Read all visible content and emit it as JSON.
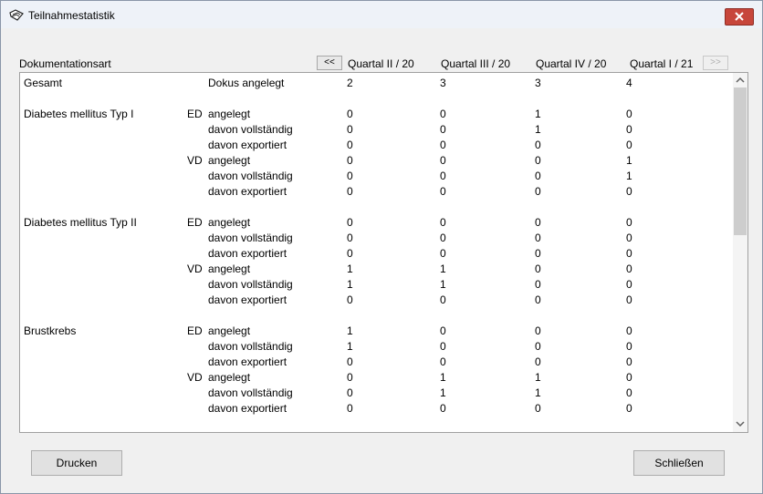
{
  "window": {
    "title": "Teilnahmestatistik",
    "close_icon": "close-icon",
    "app_icon": "app-icon"
  },
  "header": {
    "column_label": "Dokumentationsart",
    "prev_label": "<<",
    "next_label": ">>",
    "quarters": [
      "Quartal II / 20",
      "Quartal III / 20",
      "Quartal IV / 20",
      "Quartal I / 21"
    ]
  },
  "rows": [
    {
      "group": "Gesamt",
      "type": "",
      "label": "Dokus angelegt",
      "values": [
        "2",
        "3",
        "3",
        "4"
      ]
    },
    {
      "group": "Diabetes mellitus Typ I",
      "type": "ED",
      "label": "angelegt",
      "values": [
        "0",
        "0",
        "1",
        "0"
      ]
    },
    {
      "group": "",
      "type": "",
      "label": "davon vollständig",
      "values": [
        "0",
        "0",
        "1",
        "0"
      ]
    },
    {
      "group": "",
      "type": "",
      "label": "davon exportiert",
      "values": [
        "0",
        "0",
        "0",
        "0"
      ]
    },
    {
      "group": "",
      "type": "VD",
      "label": "angelegt",
      "values": [
        "0",
        "0",
        "0",
        "1"
      ]
    },
    {
      "group": "",
      "type": "",
      "label": "davon vollständig",
      "values": [
        "0",
        "0",
        "0",
        "1"
      ]
    },
    {
      "group": "",
      "type": "",
      "label": "davon exportiert",
      "values": [
        "0",
        "0",
        "0",
        "0"
      ]
    },
    {
      "group": "Diabetes mellitus Typ II",
      "type": "ED",
      "label": "angelegt",
      "values": [
        "0",
        "0",
        "0",
        "0"
      ]
    },
    {
      "group": "",
      "type": "",
      "label": "davon vollständig",
      "values": [
        "0",
        "0",
        "0",
        "0"
      ]
    },
    {
      "group": "",
      "type": "",
      "label": "davon exportiert",
      "values": [
        "0",
        "0",
        "0",
        "0"
      ]
    },
    {
      "group": "",
      "type": "VD",
      "label": "angelegt",
      "values": [
        "1",
        "1",
        "0",
        "0"
      ]
    },
    {
      "group": "",
      "type": "",
      "label": "davon vollständig",
      "values": [
        "1",
        "1",
        "0",
        "0"
      ]
    },
    {
      "group": "",
      "type": "",
      "label": "davon exportiert",
      "values": [
        "0",
        "0",
        "0",
        "0"
      ]
    },
    {
      "group": "Brustkrebs",
      "type": "ED",
      "label": "angelegt",
      "values": [
        "1",
        "0",
        "0",
        "0"
      ]
    },
    {
      "group": "",
      "type": "",
      "label": "davon vollständig",
      "values": [
        "1",
        "0",
        "0",
        "0"
      ]
    },
    {
      "group": "",
      "type": "",
      "label": "davon exportiert",
      "values": [
        "0",
        "0",
        "0",
        "0"
      ]
    },
    {
      "group": "",
      "type": "VD",
      "label": "angelegt",
      "values": [
        "0",
        "1",
        "1",
        "0"
      ]
    },
    {
      "group": "",
      "type": "",
      "label": "davon vollständig",
      "values": [
        "0",
        "1",
        "1",
        "0"
      ]
    },
    {
      "group": "",
      "type": "",
      "label": "davon exportiert",
      "values": [
        "0",
        "0",
        "0",
        "0"
      ]
    }
  ],
  "buttons": {
    "print": "Drucken",
    "close": "Schließen"
  }
}
